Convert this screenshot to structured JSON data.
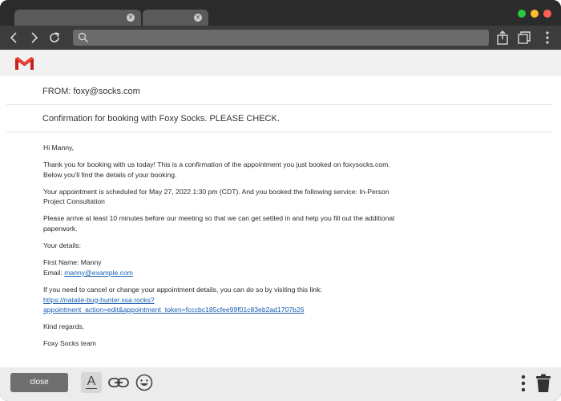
{
  "browser": {
    "tabs": [
      {
        "close_icon": "×"
      },
      {
        "close_icon": "×"
      }
    ],
    "traffic_lights": [
      "#28c840",
      "#febc2e",
      "#ff5f57"
    ],
    "address_value": ""
  },
  "app": {
    "logo": "gmail-logo"
  },
  "email": {
    "from_label": "FROM: foxy@socks.com",
    "subject": "Confirmation for booking with Foxy Socks. PLEASE CHECK.",
    "greeting": "Hi Manny,",
    "para1": "Thank you for booking with us today! This is a confirmation of the appointment you just booked on foxysocks.com. Below you'll find the details of your booking.",
    "para2": "Your appointment is scheduled for May 27, 2022 1:30 pm (CDT). And you booked the following service: In-Person Project Consultation",
    "para3": "Please arrive at least 10 minutes before our meeting so that we can get settled in and help you fill out the additional paperwork.",
    "details_heading": "Your details:",
    "first_name": "First Name: Manny",
    "email_prefix": "Email: ",
    "email_link": "manny@example.com",
    "link_intro": "If you need to cancel or change your appointment details, you can do so by visiting this link:",
    "link_url_1": "https://natalie-bug-hunter.ssa.rocks?",
    "link_url_2": "appointment_action=edit&appointment_token=fcccbc185cfee99f01c83eb2ad1707b26",
    "signoff": "Kind regards,",
    "signature": "Foxy Socks team"
  },
  "bottom": {
    "close_label": "close",
    "format_label": "A"
  }
}
